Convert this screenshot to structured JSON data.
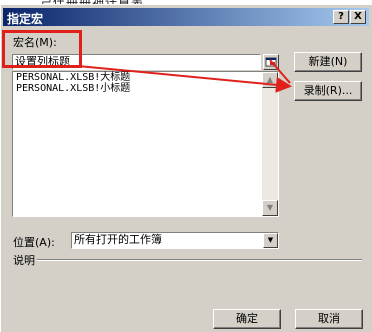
{
  "background": {
    "partial_text": "ㄕ伴冊冊神计算表"
  },
  "window": {
    "title": "指定宏",
    "help_label": "?",
    "close_label": "X"
  },
  "macro_name": {
    "label": "宏名(M):",
    "value": "设置列标题"
  },
  "macro_list": {
    "items": [
      "PERSONAL.XLSB!大标题",
      "PERSONAL.XLSB!小标题"
    ]
  },
  "buttons": {
    "new": "新建(N)",
    "record": "录制(R)...",
    "ok": "确定",
    "cancel": "取消"
  },
  "location": {
    "label": "位置(A):",
    "value": "所有打开的工作簿"
  },
  "description": {
    "label": "说明"
  },
  "colors": {
    "annotation": "#e0201a",
    "title_bar": "#0a246a",
    "face": "#d4d0c8"
  },
  "icons": {
    "collapse": "range-collapse-icon",
    "scroll_up": "scroll-up-icon",
    "scroll_down": "scroll-down-icon",
    "dropdown": "chevron-down-icon"
  }
}
